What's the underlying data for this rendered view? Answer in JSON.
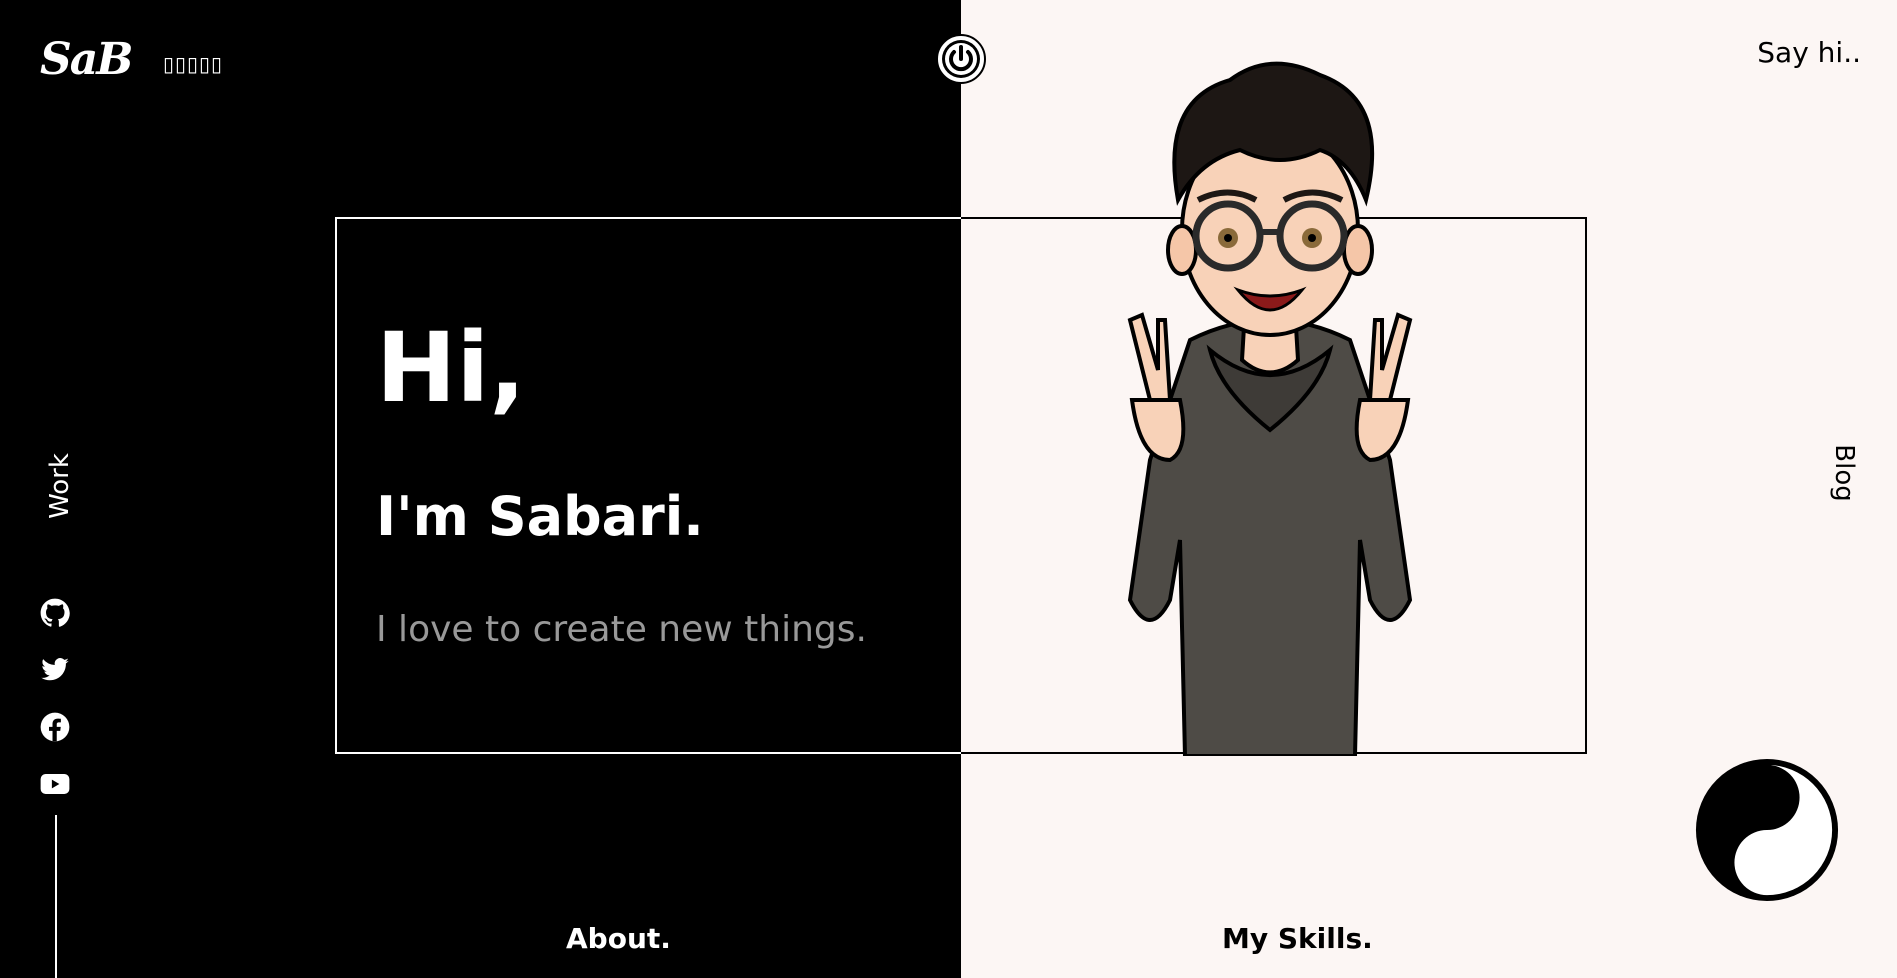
{
  "header": {
    "logo_text": "SaB",
    "logo_subtitle": "▯▯▯▯▯",
    "say_hi_label": "Say hi.."
  },
  "nav": {
    "work_label": "Work",
    "blog_label": "Blog",
    "about_label": "About.",
    "skills_label": "My Skills."
  },
  "hero": {
    "greeting": "Hi,",
    "name": "I'm Sabari.",
    "tagline": "I love to create new things."
  },
  "social": [
    {
      "icon": "github-icon"
    },
    {
      "icon": "twitter-icon"
    },
    {
      "icon": "facebook-icon"
    },
    {
      "icon": "youtube-icon"
    }
  ],
  "colors": {
    "dark_bg": "#000000",
    "light_bg": "#fcf6f4",
    "text_muted": "#999999"
  }
}
